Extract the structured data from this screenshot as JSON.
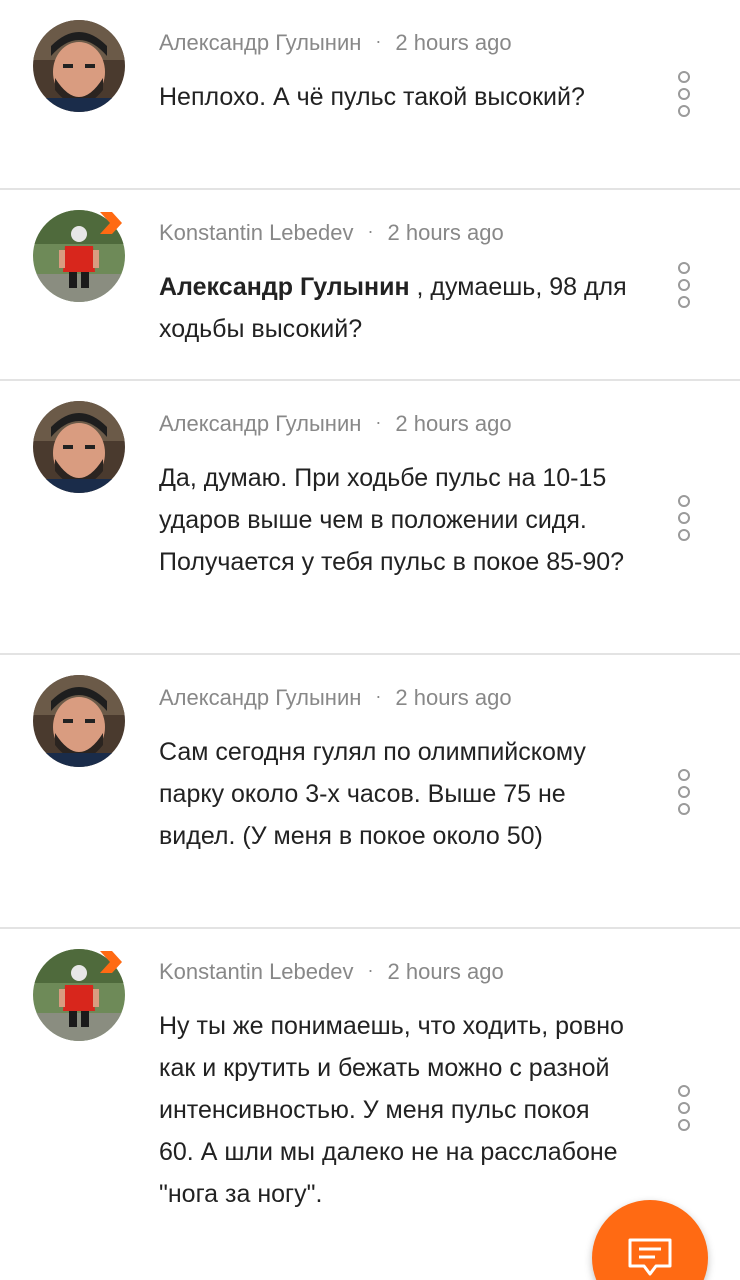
{
  "comments": [
    {
      "author": "Александр Гулынин",
      "time": "2 hours ago",
      "mention": "",
      "text": "Неплохо. А чё пульс такой высокий?",
      "avatar": "bearded-man-avatar",
      "badge": false
    },
    {
      "author": "Konstantin Lebedev",
      "time": "2 hours ago",
      "mention": "Александр Гулынин",
      "text": " , думаешь, 98 для ходьбы высокий?",
      "avatar": "cyclist-avatar",
      "badge": true
    },
    {
      "author": "Александр Гулынин",
      "time": "2 hours ago",
      "mention": "",
      "text": "Да, думаю. При ходьбе пульс на 10-15 ударов выше чем в положении сидя. Получается у тебя пульс в покое 85-90?",
      "avatar": "bearded-man-avatar",
      "badge": false
    },
    {
      "author": "Александр Гулынин",
      "time": "2 hours ago",
      "mention": "",
      "text": "Сам сегодня гулял по олимпийскому парку около 3-х часов. Выше 75 не видел. (У меня в покое около 50)",
      "avatar": "bearded-man-avatar",
      "badge": false
    },
    {
      "author": "Konstantin Lebedev",
      "time": "2 hours ago",
      "mention": "",
      "text": "Ну ты же понимаешь, что ходить, ровно как и крутить и бежать можно с разной интенсивностью. У меня пульс покоя 60. А шли мы далеко не на расслабоне \"нога за ногу\".",
      "avatar": "cyclist-avatar",
      "badge": true
    }
  ],
  "separator_symbol": "·",
  "fab": {
    "icon": "comment-icon",
    "color": "#ff6a13"
  }
}
